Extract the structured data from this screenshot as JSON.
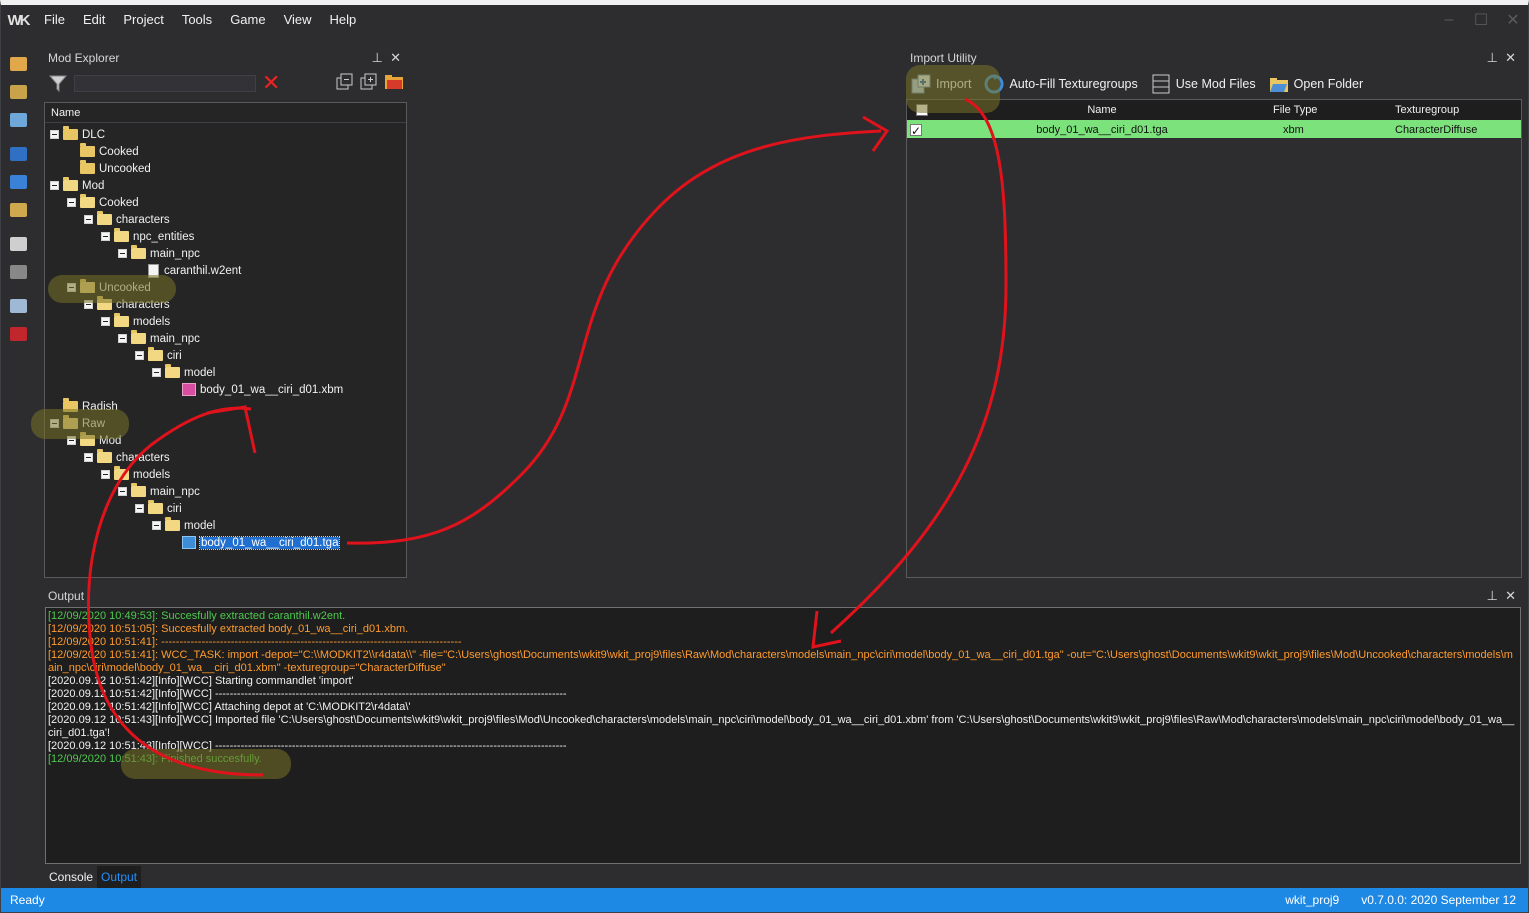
{
  "menu": [
    "File",
    "Edit",
    "Project",
    "Tools",
    "Game",
    "View",
    "Help"
  ],
  "colors": {
    "accent": "#1e88e5",
    "row_green": "#7ce27c",
    "log_green": "#4ec94e",
    "log_orange": "#ff9b2e",
    "annotation_red": "#e0121b",
    "folder": "#e8c663"
  },
  "explorer": {
    "title": "Mod Explorer",
    "filter_value": "",
    "column_name": "Name",
    "tree": [
      {
        "label": "DLC",
        "level": 0,
        "expander": true,
        "icon": "folder"
      },
      {
        "label": "Cooked",
        "level": 1,
        "expander": false,
        "icon": "folder"
      },
      {
        "label": "Uncooked",
        "level": 1,
        "expander": false,
        "icon": "folder"
      },
      {
        "label": "Mod",
        "level": 0,
        "expander": true,
        "icon": "folder-open"
      },
      {
        "label": "Cooked",
        "level": 1,
        "expander": true,
        "icon": "folder-open"
      },
      {
        "label": "characters",
        "level": 2,
        "expander": true,
        "icon": "folder-open"
      },
      {
        "label": "npc_entities",
        "level": 3,
        "expander": true,
        "icon": "folder-open"
      },
      {
        "label": "main_npc",
        "level": 4,
        "expander": true,
        "icon": "folder-open"
      },
      {
        "label": "caranthil.w2ent",
        "level": 5,
        "expander": false,
        "icon": "file-doc"
      },
      {
        "label": "Uncooked",
        "level": 1,
        "expander": true,
        "icon": "folder-open"
      },
      {
        "label": "characters",
        "level": 2,
        "expander": true,
        "icon": "folder-open"
      },
      {
        "label": "models",
        "level": 3,
        "expander": true,
        "icon": "folder-open"
      },
      {
        "label": "main_npc",
        "level": 4,
        "expander": true,
        "icon": "folder-open"
      },
      {
        "label": "ciri",
        "level": 5,
        "expander": true,
        "icon": "folder-open"
      },
      {
        "label": "model",
        "level": 6,
        "expander": true,
        "icon": "folder-open"
      },
      {
        "label": "body_01_wa__ciri_d01.xbm",
        "level": 7,
        "expander": false,
        "icon": "file-img"
      },
      {
        "label": "Radish",
        "level": 0,
        "expander": false,
        "icon": "folder"
      },
      {
        "label": "Raw",
        "level": 0,
        "expander": true,
        "icon": "folder-open"
      },
      {
        "label": "Mod",
        "level": 1,
        "expander": true,
        "icon": "folder-open"
      },
      {
        "label": "characters",
        "level": 2,
        "expander": true,
        "icon": "folder-open"
      },
      {
        "label": "models",
        "level": 3,
        "expander": true,
        "icon": "folder-open"
      },
      {
        "label": "main_npc",
        "level": 4,
        "expander": true,
        "icon": "folder-open"
      },
      {
        "label": "ciri",
        "level": 5,
        "expander": true,
        "icon": "folder-open"
      },
      {
        "label": "model",
        "level": 6,
        "expander": true,
        "icon": "folder-open"
      },
      {
        "label": "body_01_wa__ciri_d01.tga",
        "level": 7,
        "expander": false,
        "icon": "file-tga",
        "selected": true
      }
    ]
  },
  "import": {
    "title": "Import Utility",
    "buttons": {
      "import": "Import",
      "autofill": "Auto-Fill Texturegroups",
      "use_mod_files": "Use Mod Files",
      "open_folder": "Open Folder"
    },
    "columns": {
      "name": "Name",
      "file_type": "File Type",
      "texturegroup": "Texturegroup"
    },
    "rows": [
      {
        "checked": true,
        "name": "body_01_wa__ciri_d01.tga",
        "file_type": "xbm",
        "texturegroup": "CharacterDiffuse"
      }
    ]
  },
  "output": {
    "title": "Output",
    "lines": [
      {
        "color": "green",
        "text": "[12/09/2020 10:49:53]: Succesfully extracted caranthil.w2ent."
      },
      {
        "color": "orange",
        "text": "[12/09/2020 10:51:05]: Succesfully extracted body_01_wa__ciri_d01.xbm."
      },
      {
        "color": "orange",
        "text": "[12/09/2020 10:51:41]: ----------------------------------------------------------------------------------"
      },
      {
        "color": "orange",
        "text": "[12/09/2020 10:51:41]: WCC_TASK: import -depot=\"C:\\\\MODKIT2\\\\r4data\\\\\" -file=\"C:\\Users\\ghost\\Documents\\wkit9\\wkit_proj9\\files\\Raw\\Mod\\characters\\models\\main_npc\\ciri\\model\\body_01_wa__ciri_d01.tga\" -out=\"C:\\Users\\ghost\\Documents\\wkit9\\wkit_proj9\\files\\Mod\\Uncooked\\characters\\models\\main_npc\\ciri\\model\\body_01_wa__ciri_d01.xbm\" -texturegroup=\"CharacterDiffuse\""
      },
      {
        "color": "white",
        "text": "[2020.09.12 10:51:42][Info][WCC] Starting commandlet 'import'"
      },
      {
        "color": "white",
        "text": "[2020.09.12 10:51:42][Info][WCC] ------------------------------------------------------------------------------------------------"
      },
      {
        "color": "white",
        "text": "[2020.09.12 10:51:42][Info][WCC] Attaching depot at 'C:\\MODKIT2\\r4data\\'"
      },
      {
        "color": "white",
        "text": "[2020.09.12 10:51:43][Info][WCC] Imported file 'C:\\Users\\ghost\\Documents\\wkit9\\wkit_proj9\\files\\Mod\\Uncooked\\characters\\models\\main_npc\\ciri\\model\\body_01_wa__ciri_d01.xbm' from 'C:\\Users\\ghost\\Documents\\wkit9\\wkit_proj9\\files\\Raw\\Mod\\characters\\models\\main_npc\\ciri\\model\\body_01_wa__ciri_d01.tga'!"
      },
      {
        "color": "white",
        "text": "[2020.09.12 10:51:43][Info][WCC] ------------------------------------------------------------------------------------------------"
      },
      {
        "color": "green",
        "text": "[12/09/2020 10:51:43]: Finished succesfully."
      }
    ],
    "tabs": [
      "Console",
      "Output"
    ],
    "active_tab": "Output"
  },
  "status": {
    "left": "Ready",
    "project": "wkit_proj9",
    "version": "v0.7.0.0: 2020 September 12"
  }
}
